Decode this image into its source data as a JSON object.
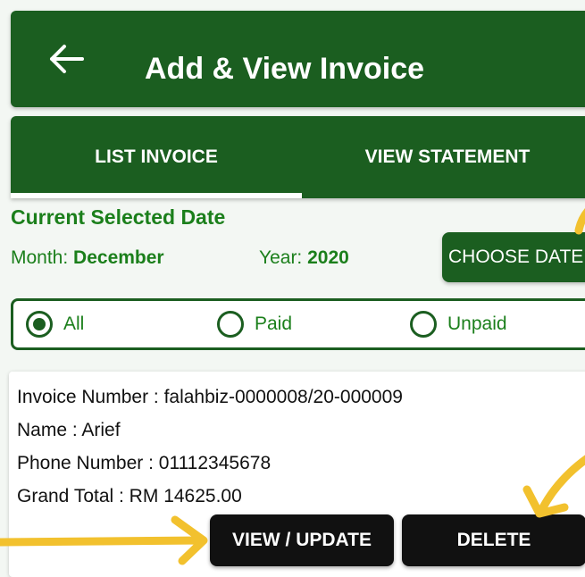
{
  "app_bar": {
    "title": "Add & View Invoice",
    "back_icon": "arrow-left-icon"
  },
  "tabs": [
    {
      "label": "LIST INVOICE",
      "selected": true
    },
    {
      "label": "VIEW STATEMENT",
      "selected": false
    }
  ],
  "date_section": {
    "title": "Current Selected Date",
    "month_label": "Month:",
    "month_value": "December",
    "year_label": "Year:",
    "year_value": "2020",
    "choose_button": "CHOOSE DATE"
  },
  "filter": {
    "options": [
      {
        "label": "All",
        "checked": true
      },
      {
        "label": "Paid",
        "checked": false
      },
      {
        "label": "Unpaid",
        "checked": false
      }
    ]
  },
  "invoice": {
    "number_label": "Invoice Number :",
    "number": "falahbiz-0000008/20-000009",
    "name_label": "Name :",
    "name": "Arief",
    "phone_label": "Phone Number :",
    "phone": "01112345678",
    "total_label": "Grand Total : RM",
    "total": "14625.00",
    "view_button": "VIEW / UPDATE",
    "delete_button": "DELETE"
  },
  "colors": {
    "primary": "#1b5e20",
    "accent_text": "#1b7f1b",
    "annotation": "#f2c12e"
  }
}
